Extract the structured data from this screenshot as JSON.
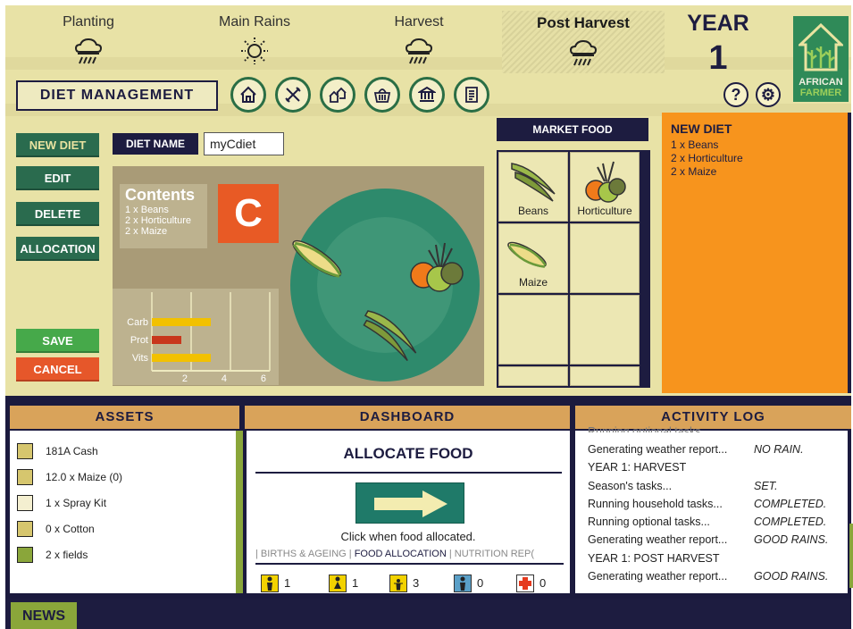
{
  "seasons": [
    {
      "name": "Planting",
      "weather_icon": "rain-cloud-icon"
    },
    {
      "name": "Main Rains",
      "weather_icon": "sun-icon"
    },
    {
      "name": "Harvest",
      "weather_icon": "rain-cloud-icon"
    },
    {
      "name": "Post Harvest",
      "weather_icon": "rain-cloud-icon",
      "current": true
    }
  ],
  "year": {
    "label": "YEAR",
    "value": "1"
  },
  "logo": {
    "line1": "AFRICAN",
    "line2": "FARMER"
  },
  "module_title": "DIET MANAGEMENT",
  "nav_icons": [
    "home-icon",
    "farm-tools-icon",
    "village-icon",
    "market-basket-icon",
    "bank-icon",
    "report-icon"
  ],
  "help_label": "?",
  "settings_label": "⚙",
  "actions": {
    "new_diet": "NEW DIET",
    "edit": "EDIT",
    "delete": "DELETE",
    "allocation": "ALLOCATION",
    "save": "SAVE",
    "cancel": "CANCEL"
  },
  "diet_name": {
    "label": "DIET NAME",
    "value": "myCdiet"
  },
  "contents": {
    "title": "Contents",
    "items": [
      "1 x Beans",
      "2 x Horticulture",
      "2 x Maize"
    ],
    "grade": "C"
  },
  "nutrition_chart": {
    "type": "bar",
    "categories": [
      "Carb",
      "Prot",
      "Vits"
    ],
    "values": [
      3,
      1.5,
      3
    ],
    "colors": [
      "#f2c100",
      "#c8371c",
      "#f2c100"
    ],
    "xticks": [
      "2",
      "4",
      "6"
    ],
    "xlim": [
      0,
      6
    ]
  },
  "market": {
    "title": "MARKET FOOD",
    "items": [
      {
        "label": "Beans",
        "icon": "beans-icon"
      },
      {
        "label": "Horticulture",
        "icon": "vegetables-icon"
      },
      {
        "label": "Maize",
        "icon": "maize-icon"
      }
    ]
  },
  "new_diet": {
    "title": "NEW DIET",
    "items": [
      "1 x Beans",
      "2 x Horticulture",
      "2 x Maize"
    ]
  },
  "panels": {
    "assets": "ASSETS",
    "dashboard": "DASHBOARD",
    "activity_log": "ACTIVITY LOG"
  },
  "assets": [
    {
      "text": "181A Cash",
      "icon": "cash-icon"
    },
    {
      "text": "12.0 x Maize (0)",
      "icon": "maize-icon"
    },
    {
      "text": "1 x Spray Kit",
      "icon": "spray-kit-icon"
    },
    {
      "text": "0 x Cotton",
      "icon": "cotton-icon"
    },
    {
      "text": "2 x fields",
      "icon": "fields-icon"
    }
  ],
  "dashboard": {
    "title": "ALLOCATE FOOD",
    "hint": "Click when food allocated.",
    "tabs": {
      "births": "BIRTHS & AGEING",
      "food": "FOOD ALLOCATION",
      "nutrition": "NUTRITION REP("
    },
    "stats": [
      {
        "value": "1",
        "icon": "adult-male-icon",
        "color": "#f2d200"
      },
      {
        "value": "1",
        "icon": "adult-female-icon",
        "color": "#f2d200"
      },
      {
        "value": "3",
        "icon": "child-icon",
        "color": "#f2d200"
      },
      {
        "value": "0",
        "icon": "elder-icon",
        "color": "#5aa0c8"
      },
      {
        "value": "0",
        "icon": "sick-cross-icon",
        "color": "#ffffff"
      }
    ]
  },
  "activity_log": [
    {
      "text": "Generating weather report...",
      "result": "NO RAIN."
    },
    {
      "text": "YEAR 1: HARVEST",
      "result": ""
    },
    {
      "text": "Season's tasks...",
      "result": "SET."
    },
    {
      "text": "Running household tasks...",
      "result": "COMPLETED."
    },
    {
      "text": "Running optional tasks...",
      "result": "COMPLETED."
    },
    {
      "text": "Generating weather report...",
      "result": "GOOD RAINS."
    },
    {
      "text": "YEAR 1: POST HARVEST",
      "result": ""
    },
    {
      "text": "Generating weather report...",
      "result": "GOOD RAINS."
    }
  ],
  "news_label": "NEWS"
}
